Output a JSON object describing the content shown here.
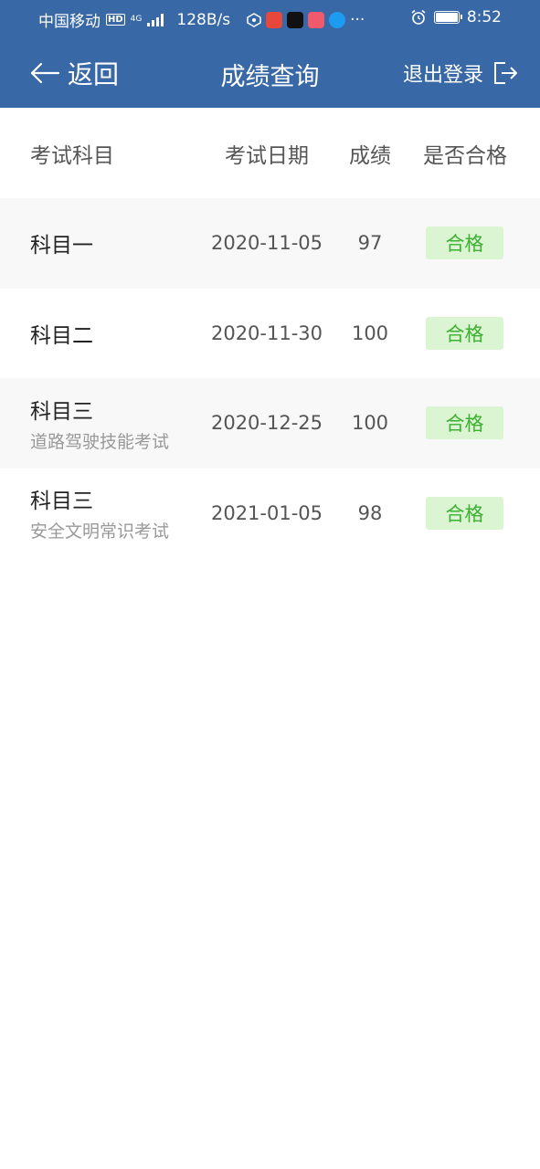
{
  "status_bar": {
    "carrier": "中国移动",
    "hd": "HD",
    "net": "4G",
    "speed": "128B/s",
    "more": "···",
    "time": "8:52"
  },
  "nav": {
    "back_label": "返回",
    "title": "成绩查询",
    "logout_label": "退出登录"
  },
  "table": {
    "headers": {
      "subject": "考试科目",
      "date": "考试日期",
      "score": "成绩",
      "pass": "是否合格"
    },
    "rows": [
      {
        "subject": "科目一",
        "sub": "",
        "date": "2020-11-05",
        "score": "97",
        "pass": "合格"
      },
      {
        "subject": "科目二",
        "sub": "",
        "date": "2020-11-30",
        "score": "100",
        "pass": "合格"
      },
      {
        "subject": "科目三",
        "sub": "道路驾驶技能考试",
        "date": "2020-12-25",
        "score": "100",
        "pass": "合格"
      },
      {
        "subject": "科目三",
        "sub": "安全文明常识考试",
        "date": "2021-01-05",
        "score": "98",
        "pass": "合格"
      }
    ]
  },
  "colors": {
    "header_bg": "#3868a5",
    "pass_bg": "#dbf5d3",
    "pass_text": "#3cb030",
    "row_shade": "#f8f8f8"
  },
  "icons": {
    "back": "arrow-left-icon",
    "logout": "logout-icon"
  }
}
